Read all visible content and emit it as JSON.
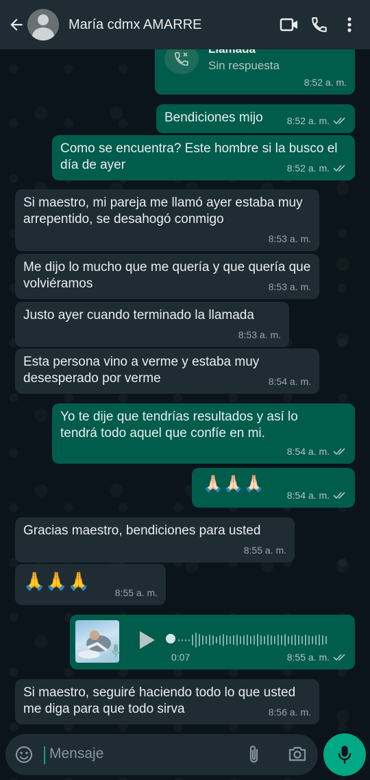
{
  "header": {
    "contact_name": "María cdmx AMARRE"
  },
  "messages": [
    {
      "dir": "out",
      "type": "call",
      "title": "Llamada",
      "subtitle": "Sin respuesta",
      "time": "8:52 a. m."
    },
    {
      "dir": "out",
      "text": "Bendiciones mijo",
      "time": "8:52 a. m."
    },
    {
      "dir": "out",
      "text": "Como se encuentra? Este hombre si la busco el día de ayer",
      "time": "8:52 a. m."
    },
    {
      "dir": "in",
      "text": "Si maestro, mi pareja me llamó ayer estaba muy arrepentido, se desahogó conmigo",
      "time": "8:53 a. m."
    },
    {
      "dir": "in",
      "text": "Me dijo lo mucho que me quería y que quería que volviéramos",
      "time": "8:53 a. m."
    },
    {
      "dir": "in",
      "text": "Justo ayer cuando terminado la llamada",
      "time": "8:53 a. m."
    },
    {
      "dir": "in",
      "text": "Esta persona vino a verme y estaba muy desesperado por verme",
      "time": "8:54 a. m."
    },
    {
      "dir": "out",
      "text": "Yo te dije que tendrías resultados y así lo tendrá todo aquel que confíe en mi.",
      "time": "8:54 a. m."
    },
    {
      "dir": "out",
      "text": "🙏🏻🙏🏻🙏🏻",
      "time": "8:54 a. m."
    },
    {
      "dir": "in",
      "text": "Gracias maestro, bendiciones para usted",
      "time": "8:55 a. m."
    },
    {
      "dir": "in",
      "text": "🙏🙏🙏",
      "time": "8:55 a. m."
    },
    {
      "dir": "out",
      "type": "voice",
      "duration": "0:07",
      "time": "8:55 a. m."
    },
    {
      "dir": "in",
      "text": "Si maestro, seguiré haciendo todo lo que usted me diga para que todo sirva",
      "time": "8:56 a. m."
    }
  ],
  "composer": {
    "placeholder": "Mensaje"
  },
  "icons": {
    "back": "arrow-left-icon",
    "video": "video-call-icon",
    "phone": "phone-icon",
    "menu": "more-vert-icon",
    "emoji": "emoji-icon",
    "attach": "paperclip-icon",
    "camera": "camera-icon",
    "mic": "microphone-icon"
  },
  "colors": {
    "outgoing_bubble": "#005c4b",
    "incoming_bubble": "#1f2c34",
    "accent": "#00a884",
    "background": "#0b141a"
  }
}
